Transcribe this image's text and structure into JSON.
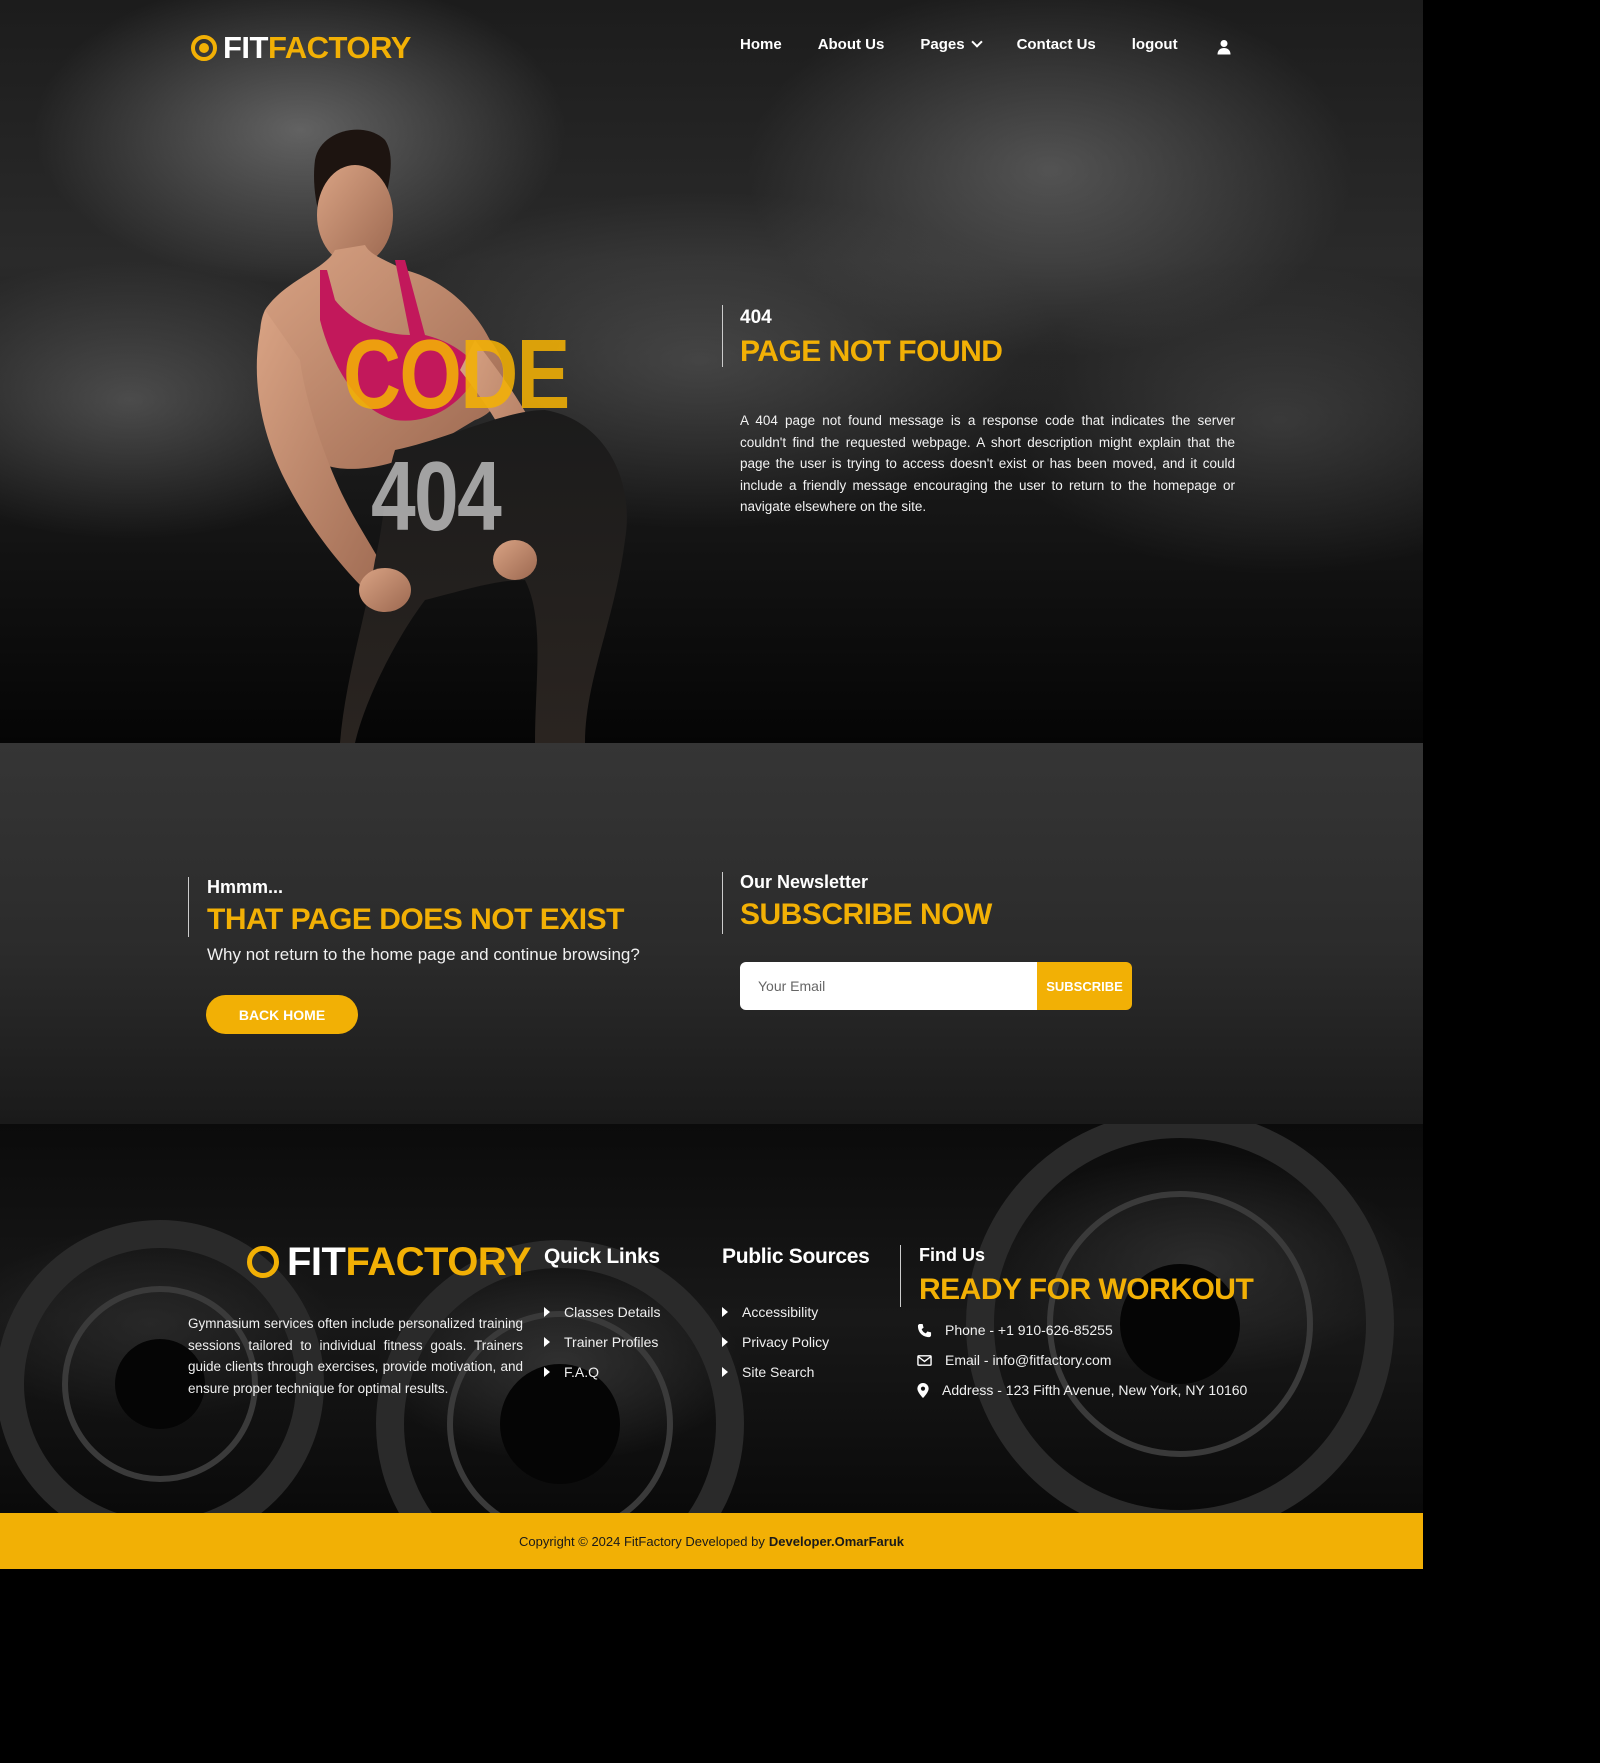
{
  "brand": {
    "part1": "FIT",
    "part2": "FACTORY",
    "accent_color": "#f2b005"
  },
  "nav": {
    "items": [
      {
        "label": "Home"
      },
      {
        "label": "About Us"
      },
      {
        "label": "Pages",
        "has_dropdown": true
      },
      {
        "label": "Contact Us"
      },
      {
        "label": "logout"
      }
    ],
    "user_icon": "user-icon"
  },
  "hero": {
    "code_word": "CODE",
    "code_number": "404",
    "subtitle": "404",
    "title": "PAGE NOT FOUND",
    "description": "A 404 page not found message is a response code that indicates the server couldn't find the requested webpage. A short description might explain that the page the user is trying to access doesn't exist or has been moved, and it could include a friendly message encouraging the user to return to the homepage or navigate elsewhere on the site."
  },
  "not_found": {
    "kicker": "Hmmm...",
    "title": "THAT PAGE DOES NOT EXIST",
    "text": "Why not return to the home page and continue browsing?",
    "button": "BACK HOME"
  },
  "newsletter": {
    "kicker": "Our Newsletter",
    "title": "SUBSCRIBE NOW",
    "email_placeholder": "Your Email",
    "button": "SUBSCRIBE"
  },
  "footer": {
    "about": "Gymnasium services often include personalized training sessions tailored to individual fitness goals. Trainers guide clients through exercises, provide motivation, and ensure proper technique for optimal results.",
    "quick_links": {
      "title": "Quick Links",
      "items": [
        "Classes Details",
        "Trainer Profiles",
        "F.A.Q"
      ]
    },
    "public_sources": {
      "title": "Public Sources",
      "items": [
        "Accessibility",
        "Privacy Policy",
        "Site Search"
      ]
    },
    "find_us": {
      "kicker": "Find Us",
      "title": "READY FOR WORKOUT",
      "phone": "Phone - +1 910-626-85255",
      "email": "Email - info@fitfactory.com",
      "address": "Address - 123 Fifth Avenue, New York, NY 10160"
    }
  },
  "copyright": {
    "text": "Copyright © 2024 FitFactory Developed by",
    "developer": "Developer.OmarFaruk"
  }
}
